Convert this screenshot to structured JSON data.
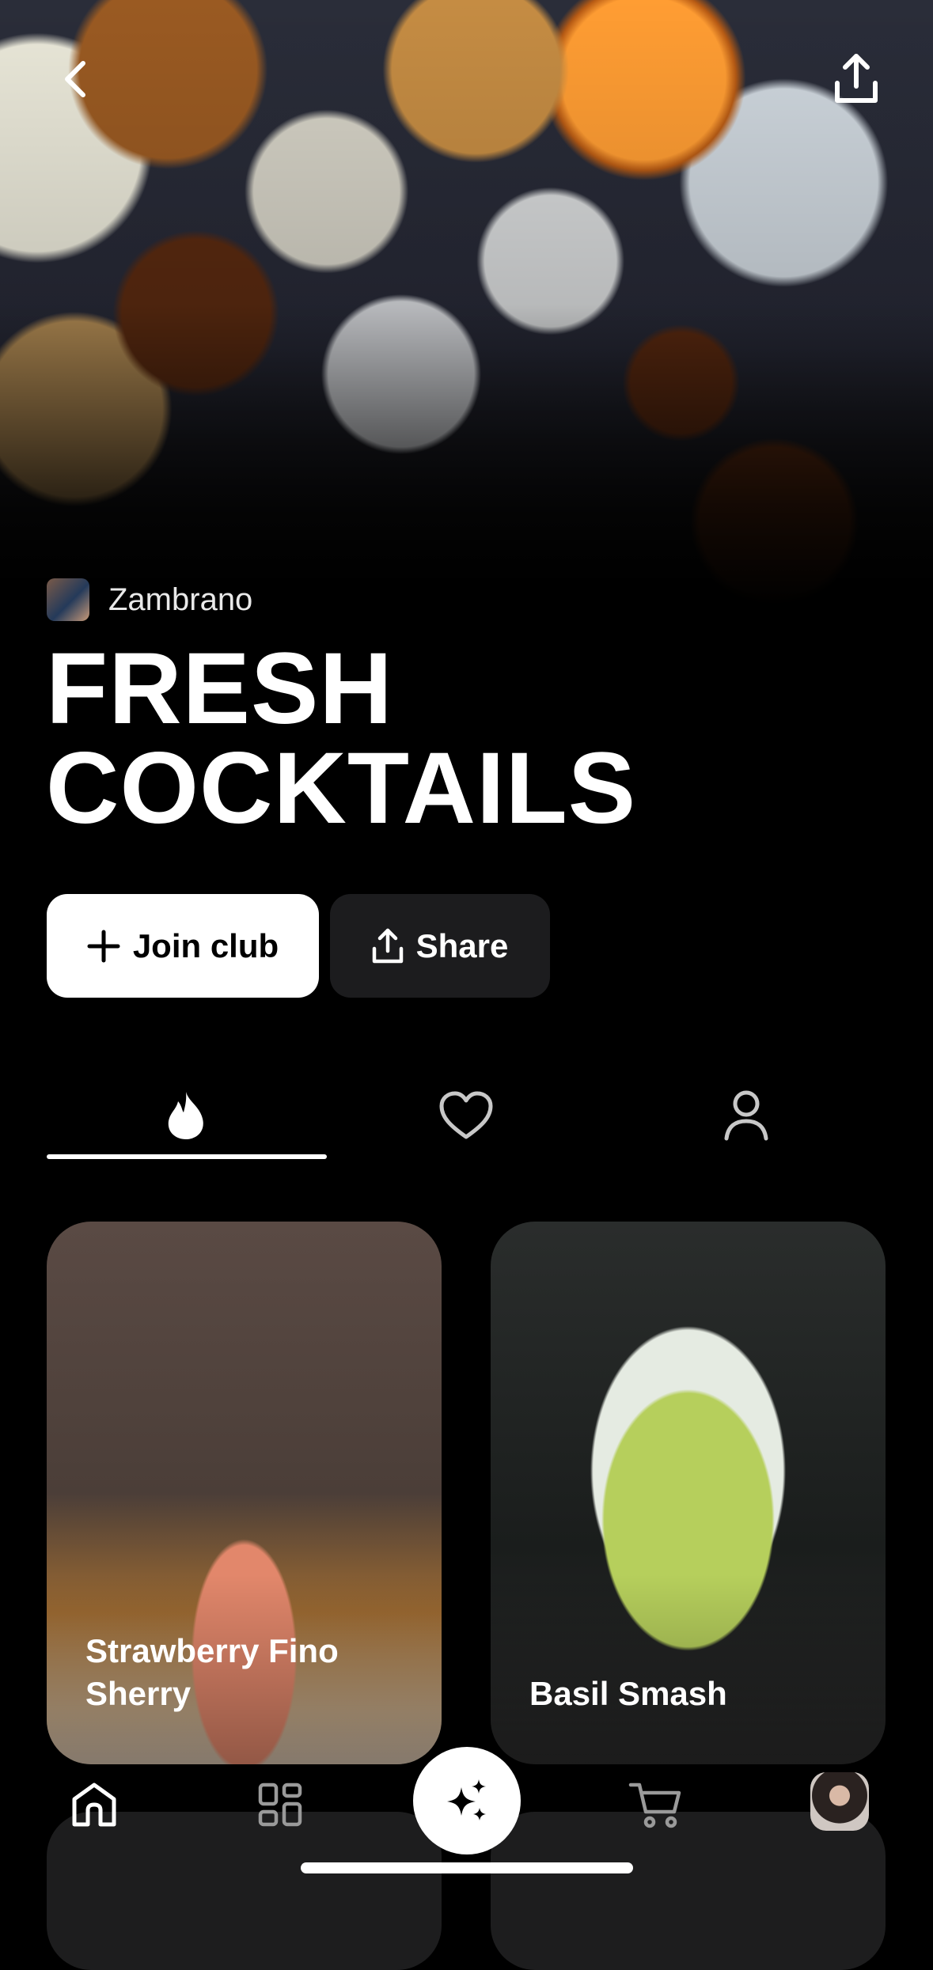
{
  "header": {
    "back_icon": "chevron-left-icon",
    "share_icon": "upload-icon"
  },
  "club": {
    "author_name": "Zambrano",
    "title_line1": "FRESH",
    "title_line2": "COCKTAILS"
  },
  "actions": {
    "join_label": "Join club",
    "share_label": "Share"
  },
  "tabs": [
    {
      "icon": "flame-icon",
      "active": true
    },
    {
      "icon": "heart-icon",
      "active": false
    },
    {
      "icon": "person-icon",
      "active": false
    }
  ],
  "cards": [
    {
      "title": "Strawberry Fino Sherry"
    },
    {
      "title": "Basil Smash"
    }
  ],
  "bottom_nav": [
    {
      "icon": "home-icon"
    },
    {
      "icon": "grid-icon"
    },
    {
      "icon": "sparkles-icon"
    },
    {
      "icon": "cart-icon"
    },
    {
      "icon": "profile-avatar"
    }
  ],
  "colors": {
    "background": "#000000",
    "primary_button": "#ffffff",
    "secondary_button": "#1c1c1e"
  }
}
